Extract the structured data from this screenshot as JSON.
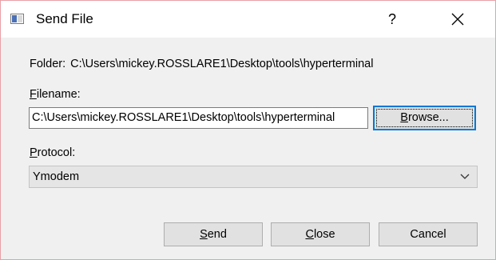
{
  "window": {
    "title": "Send File",
    "help_label": "?",
    "icons": {
      "app": "window-app-icon",
      "close": "close-icon",
      "dropdown": "chevron-down-icon"
    },
    "colors": {
      "border": "#e8a0a6",
      "background": "#f0f0f0",
      "accent": "#0078d7"
    }
  },
  "folder": {
    "label": "Folder:",
    "path": "C:\\Users\\mickey.ROSSLARE1\\Desktop\\tools\\hyperterminal"
  },
  "filename": {
    "label_first": "F",
    "label_rest": "ilename:",
    "value": "C:\\Users\\mickey.ROSSLARE1\\Desktop\\tools\\hyperterminal"
  },
  "browse": {
    "label_first": "B",
    "label_rest": "rowse..."
  },
  "protocol": {
    "label_first": "P",
    "label_rest": "rotocol:",
    "selected": "Ymodem"
  },
  "actions": {
    "send_first": "S",
    "send_rest": "end",
    "close_first": "C",
    "close_rest": "lose",
    "cancel": "Cancel"
  }
}
